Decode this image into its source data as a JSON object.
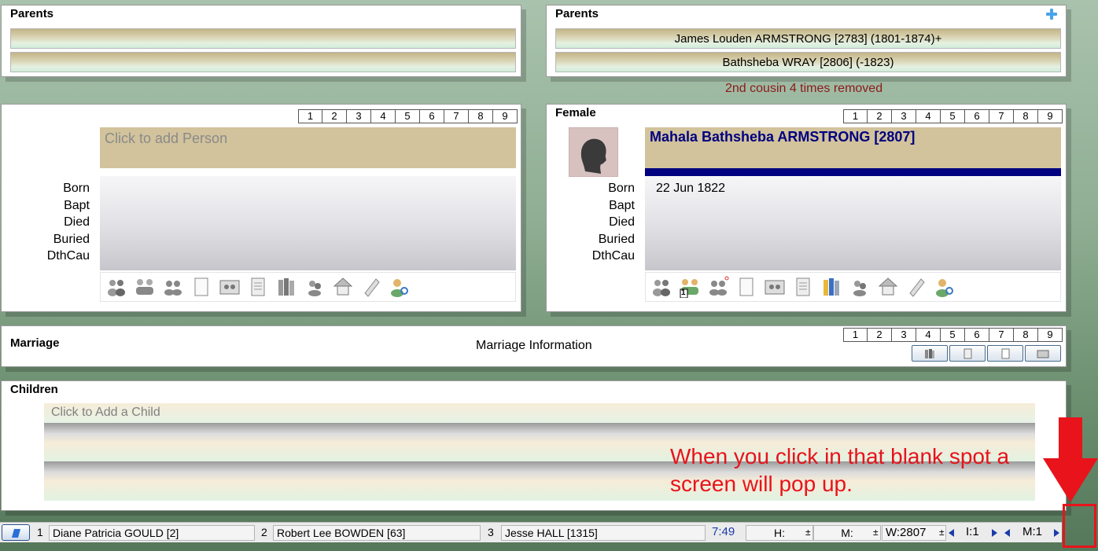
{
  "father_parents": {
    "title": "Parents",
    "father": "",
    "mother": ""
  },
  "mother_parents": {
    "title": "Parents",
    "father": "James Louden ARMSTRONG [2783] (1801-1874)+",
    "mother": "Bathsheba WRAY [2806] (-1823)",
    "add_icon": "plus-icon"
  },
  "relationship": "2nd cousin 4 times removed",
  "person_tabs": [
    "1",
    "2",
    "3",
    "4",
    "5",
    "6",
    "7",
    "8",
    "9"
  ],
  "left_person": {
    "placeholder": "Click to add Person",
    "labels": [
      "Born",
      "Bapt",
      "Died",
      "Buried",
      "DthCau"
    ],
    "values": [
      "",
      "",
      "",
      "",
      ""
    ]
  },
  "right_person": {
    "title": "Female",
    "name": "Mahala Bathsheba ARMSTRONG [2807]",
    "labels": [
      "Born",
      "Bapt",
      "Died",
      "Buried",
      "DthCau"
    ],
    "values": [
      "22 Jun 1822",
      "",
      "",
      "",
      ""
    ],
    "badge": "1",
    "accent": "#000080"
  },
  "marriage": {
    "title": "Marriage",
    "info": "Marriage Information"
  },
  "children": {
    "title": "Children",
    "placeholder": "Click to Add a Child"
  },
  "annotation": {
    "line1": "When you click in that blank spot a",
    "line2": "screen will pop up.",
    "color": "#e8131b"
  },
  "status": {
    "slot1_num": "1",
    "slot1_name": "Diane Patricia GOULD [2]",
    "slot2_num": "2",
    "slot2_name": "Robert Lee BOWDEN [63]",
    "slot3_num": "3",
    "slot3_name": "Jesse HALL [1315]",
    "time": "7:49",
    "h": "H:",
    "m": "M:",
    "pm": "±",
    "w": "W:2807",
    "i": "I:1",
    "mm": "M:1"
  }
}
